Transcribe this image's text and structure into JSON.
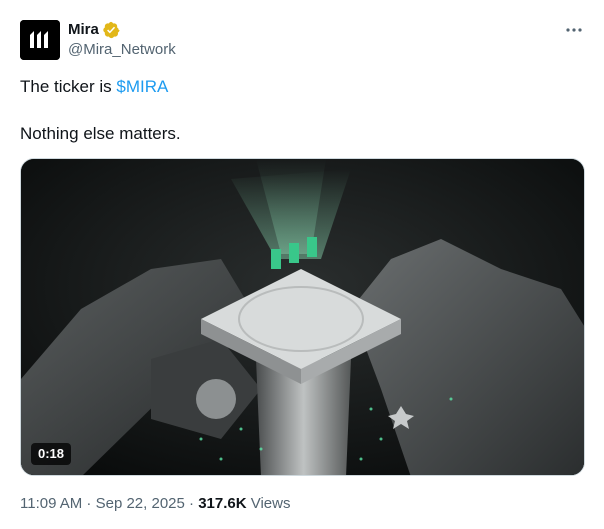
{
  "author": {
    "display_name": "Mira",
    "handle": "@Mira_Network",
    "avatar_icon": "mira-logo-icon",
    "verified_icon": "gold-verified-badge-icon",
    "verified_color": "#e2b719"
  },
  "tweet": {
    "text_prefix": "The ticker is ",
    "cashtag": "$MIRA",
    "line2": "Nothing else matters."
  },
  "media": {
    "duration": "0:18"
  },
  "meta": {
    "time": "11:09 AM",
    "separator1": " · ",
    "date": "Sep 22, 2025",
    "separator2": " · ",
    "views_count": "317.6K",
    "views_label": " Views"
  },
  "colors": {
    "link": "#1d9bf0",
    "secondary_text": "#536471"
  }
}
